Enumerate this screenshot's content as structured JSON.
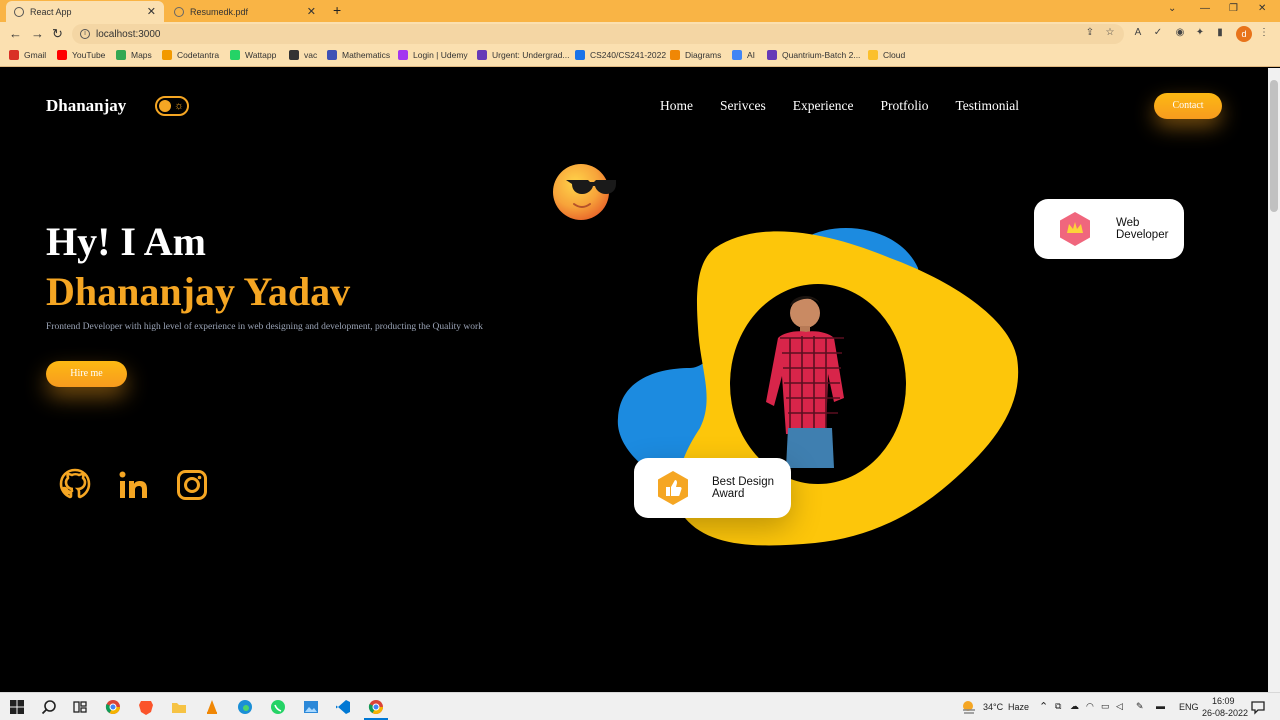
{
  "browser": {
    "tabs": [
      {
        "title": "React App",
        "active": true
      },
      {
        "title": "Resumedk.pdf",
        "active": false
      }
    ],
    "url": "localhost:3000",
    "bookmarks": [
      {
        "label": "Gmail",
        "color": "#d93025"
      },
      {
        "label": "YouTube",
        "color": "#ff0000"
      },
      {
        "label": "Maps",
        "color": "#34a853"
      },
      {
        "label": "Codetantra",
        "color": "#f29900"
      },
      {
        "label": "Wattapp",
        "color": "#25d366"
      },
      {
        "label": "vac",
        "color": "#333333"
      },
      {
        "label": "Mathematics",
        "color": "#3f51b5"
      },
      {
        "label": "Login | Udemy",
        "color": "#a435f0"
      },
      {
        "label": "Urgent: Undergrad...",
        "color": "#673ab7"
      },
      {
        "label": "CS240/CS241-2022",
        "color": "#1a73e8"
      },
      {
        "label": "Diagrams",
        "color": "#f08705"
      },
      {
        "label": "AI",
        "color": "#4285f4"
      },
      {
        "label": "Quantrium-Batch 2...",
        "color": "#673ab7"
      },
      {
        "label": "Cloud",
        "color": "#fbc02d"
      }
    ],
    "profile_initial": "d"
  },
  "site": {
    "brand": "Dhananjay",
    "nav": [
      "Home",
      "Serivces",
      "Experience",
      "Protfolio",
      "Testimonial"
    ],
    "contact_label": "Contact",
    "hero_hi": "Hy! I Am",
    "hero_name": "Dhananjay Yadav",
    "hero_desc": "Frontend Developer with high level of experience in web designing and development, producting the Quality work",
    "hire_label": "Hire me",
    "cards": {
      "web": "Web Developer",
      "award": "Best Design Award"
    },
    "accent": "#f5a623",
    "blob_yellow": "#fdc60a",
    "blob_blue": "#1c8be0"
  },
  "taskbar": {
    "weather_temp": "34°C",
    "weather_desc": "Haze",
    "lang": "ENG",
    "time": "16:09",
    "date": "26-08-2022"
  }
}
